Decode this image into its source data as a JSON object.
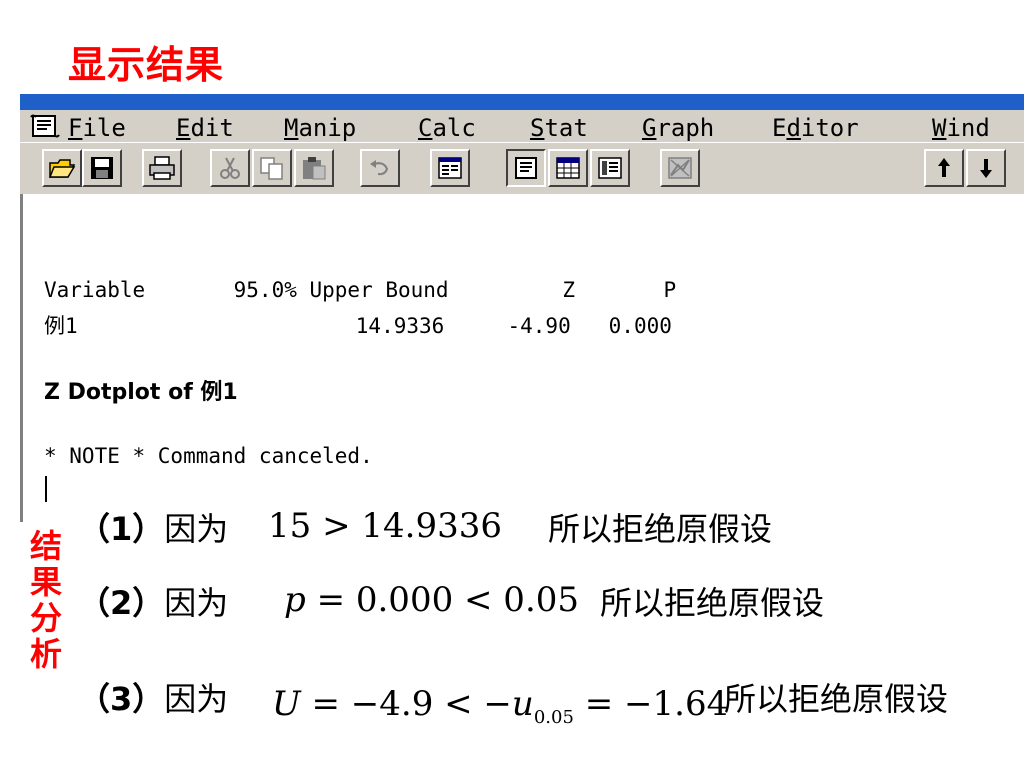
{
  "slide": {
    "title": "显示结果",
    "side_label": [
      "结",
      "果",
      "分",
      "析"
    ]
  },
  "window": {
    "menu": [
      "File",
      "Edit",
      "Manip",
      "Calc",
      "Stat",
      "Graph",
      "Editor",
      "Wind"
    ],
    "menu_underline": [
      "F",
      "E",
      "M",
      "C",
      "S",
      "G",
      "d",
      "W"
    ],
    "toolbar_icons": [
      "open-folder-icon",
      "save-disk-icon",
      "print-icon",
      "cut-icon",
      "copy-icon",
      "paste-icon",
      "undo-icon",
      "session-window-icon",
      "session-icon",
      "data-window-icon",
      "info-window-icon",
      "graph-manage-icon",
      "up-arrow-icon",
      "down-arrow-icon"
    ]
  },
  "session": {
    "header": "Variable       95.0% Upper Bound         Z       P",
    "row": "例1                      14.9336     -4.90   0.000",
    "dotplot_title": "Z Dotplot of 例1",
    "note": "* NOTE * Command canceled."
  },
  "conclusions": [
    {
      "num": "（1）",
      "because": "因为",
      "expr_a": "15 > 14.9336",
      "result": "所以拒绝原假设"
    },
    {
      "num": "（2）",
      "because": "因为",
      "expr_var": "p",
      "expr_rest": " = 0.000 < 0.05",
      "result": "所以拒绝原假设"
    },
    {
      "num": "（3）",
      "because": "因为",
      "expr_var": "U",
      "expr_mid": " = −4.9 < −",
      "expr_u": "u",
      "expr_sub": "0.05",
      "expr_end": " = −1.64",
      "result": "所以拒绝原假设"
    }
  ],
  "colors": {
    "title": "#ff0000",
    "menubar": "#d4d0c8",
    "titlebar": "#1f5fc8"
  }
}
